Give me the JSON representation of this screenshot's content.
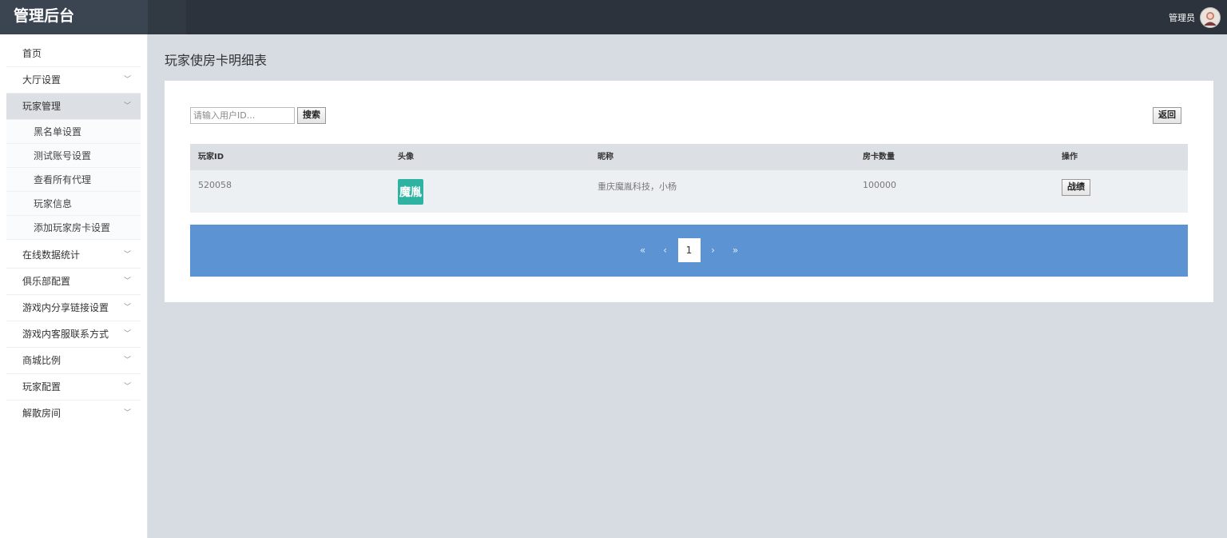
{
  "app": {
    "title": "管理后台",
    "user": "管理员"
  },
  "sidebar": {
    "items": [
      {
        "label": "首页"
      },
      {
        "label": "大厅设置"
      },
      {
        "label": "玩家管理"
      },
      {
        "label": "在线数据统计"
      },
      {
        "label": "俱乐部配置"
      },
      {
        "label": "游戏内分享链接设置"
      },
      {
        "label": "游戏内客服联系方式"
      },
      {
        "label": "商城比例"
      },
      {
        "label": "玩家配置"
      },
      {
        "label": "解散房间"
      }
    ],
    "sub_items": [
      {
        "label": "黑名单设置"
      },
      {
        "label": "测试账号设置"
      },
      {
        "label": "查看所有代理"
      },
      {
        "label": "玩家信息"
      },
      {
        "label": "添加玩家房卡设置"
      }
    ]
  },
  "main": {
    "title": "玩家使房卡明细表",
    "search": {
      "placeholder": "请输入用户ID...",
      "value": "",
      "button": "搜索"
    },
    "back_button": "返回",
    "table": {
      "columns": [
        "玩家ID",
        "头像",
        "昵称",
        "房卡数量",
        "操作"
      ],
      "rows": [
        {
          "player_id": "520058",
          "avatar_text": "魔胤",
          "nickname": "重庆魔胤科技，小杨",
          "card_count": "100000",
          "action": "战绩"
        }
      ]
    },
    "pagination": {
      "first": "«",
      "prev": "‹",
      "current": "1",
      "next": "›",
      "last": "»"
    }
  },
  "colors": {
    "topbar": "#2c333c",
    "pager_bar": "#5b93d3",
    "avatar_bg": "#2eb3a2"
  }
}
